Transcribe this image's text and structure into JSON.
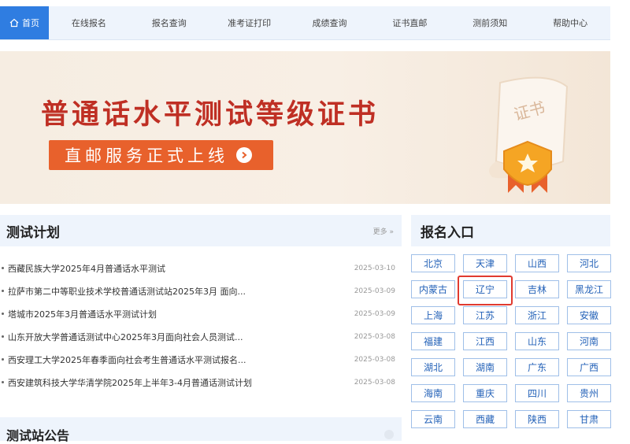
{
  "nav": {
    "home": "首页",
    "items": [
      "在线报名",
      "报名查询",
      "准考证打印",
      "成绩查询",
      "证书直邮",
      "测前须知",
      "帮助中心"
    ]
  },
  "banner": {
    "title": "普通话水平测试等级证书",
    "subtitle": "直邮服务正式上线",
    "stamp_text": "证书"
  },
  "test_plan": {
    "title": "测试计划",
    "more": "更多 »",
    "items": [
      {
        "title": "西藏民族大学2025年4月普通话水平测试",
        "date": "2025-03-10"
      },
      {
        "title": "拉萨市第二中等职业技术学校普通话测试站2025年3月 面向...",
        "date": "2025-03-09"
      },
      {
        "title": "塔城市2025年3月普通话水平测试计划",
        "date": "2025-03-09"
      },
      {
        "title": "山东开放大学普通话测试中心2025年3月面向社会人员测试...",
        "date": "2025-03-08"
      },
      {
        "title": "西安理工大学2025年春季面向社会考生普通话水平测试报名...",
        "date": "2025-03-08"
      },
      {
        "title": "西安建筑科技大学华清学院2025年上半年3-4月普通话测试计划",
        "date": "2025-03-08"
      }
    ]
  },
  "next_section": {
    "title": "测试站公告"
  },
  "registration": {
    "title": "报名入口",
    "provinces": [
      "北京",
      "天津",
      "山西",
      "河北",
      "内蒙古",
      "辽宁",
      "吉林",
      "黑龙江",
      "上海",
      "江苏",
      "浙江",
      "安徽",
      "福建",
      "江西",
      "山东",
      "河南",
      "湖北",
      "湖南",
      "广东",
      "广西",
      "海南",
      "重庆",
      "四川",
      "贵州",
      "云南",
      "西藏",
      "陕西",
      "甘肃"
    ],
    "highlighted": "辽宁"
  },
  "colors": {
    "accent": "#2f7de1",
    "banner_title": "#bf2f24",
    "banner_pill": "#e8612c",
    "highlight": "#e03a2f"
  }
}
